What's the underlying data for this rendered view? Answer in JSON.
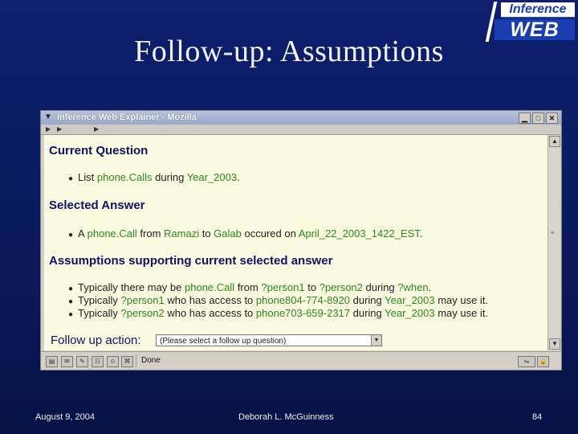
{
  "slide": {
    "title": "Follow-up: Assumptions",
    "logo_top": "Inference",
    "logo_bottom": "WEB",
    "footer_date": "August 9, 2004",
    "footer_author": "Deborah L. McGuinness",
    "page_number": "84"
  },
  "window": {
    "title": "Inference Web Explainer - Mozilla",
    "status": "Done"
  },
  "content": {
    "current_question_heading": "Current Question",
    "question": {
      "prefix": "List ",
      "p1": "phone.Calls",
      "mid": " during ",
      "p2": "Year_2003",
      "suffix": "."
    },
    "selected_answer_heading": "Selected Answer",
    "answer": {
      "prefix": "A ",
      "p1": "phone.Call",
      "m1": " from ",
      "p2": "Ramazi",
      "m2": " to ",
      "p3": "Galab",
      "m3": " occured on ",
      "p4": "April_22_2003_1422_EST",
      "suffix": "."
    },
    "assumptions_heading": "Assumptions supporting current selected answer",
    "assumptions": [
      {
        "a": "Typically there may be ",
        "b": "phone.Call",
        "c": " from ",
        "d": "?person1",
        "e": " to ",
        "f": "?person2",
        "g": " during ",
        "h": "?when",
        "i": "."
      },
      {
        "a": "Typically ",
        "b": "?person1",
        "c": " who has access to ",
        "d": "phone804-774-8920",
        "e": " during ",
        "f": "Year_2003",
        "g": " may use it.",
        "h": "",
        "i": ""
      },
      {
        "a": "Typically ",
        "b": "?person2",
        "c": " who has access to ",
        "d": "phone703-659-2317",
        "e": " during ",
        "f": "Year_2003",
        "g": " may use it.",
        "h": "",
        "i": ""
      }
    ],
    "follow_up_label": "Follow up action:",
    "follow_up_selected": "(Please select a follow up question)"
  },
  "colors": {
    "link_green": "#2b8a1e",
    "heading_blue": "#111166",
    "page_bg": "#fafae0"
  }
}
